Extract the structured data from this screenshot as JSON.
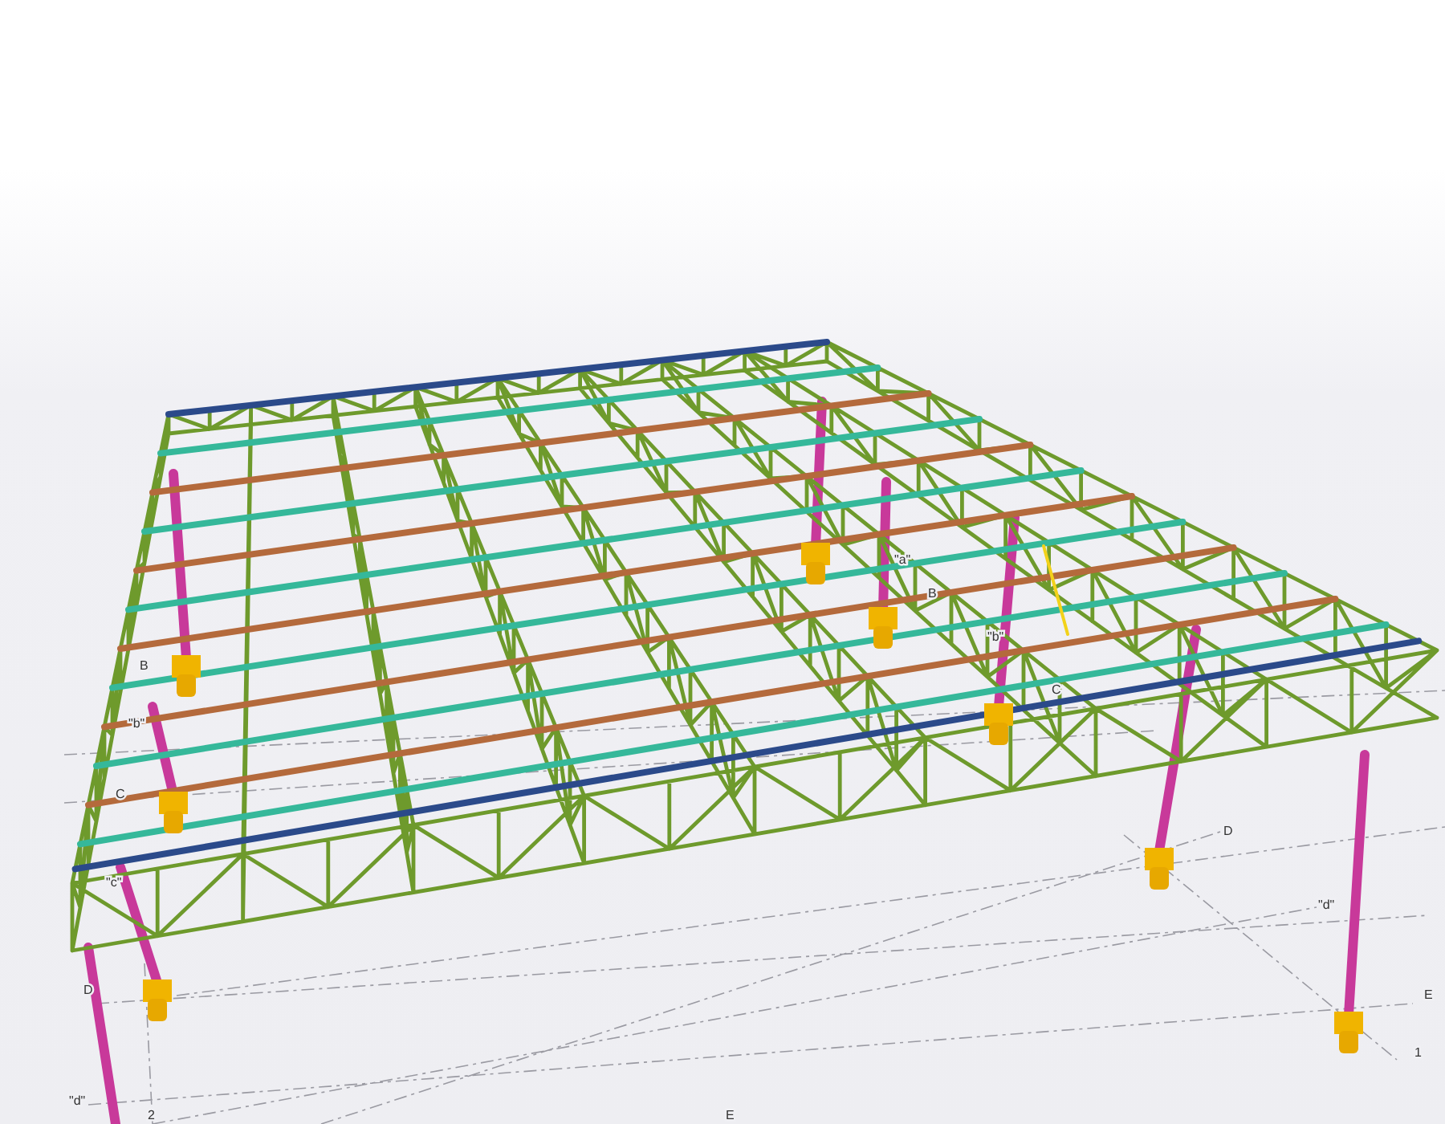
{
  "model_view": {
    "grid_labels": [
      "B",
      "\"b\"",
      "C",
      "\"c\"",
      "D",
      "\"d\"",
      "2",
      "\"a\"",
      "B",
      "\"b\"",
      "C",
      "D",
      "\"d\"",
      "E",
      "1",
      "E"
    ]
  }
}
